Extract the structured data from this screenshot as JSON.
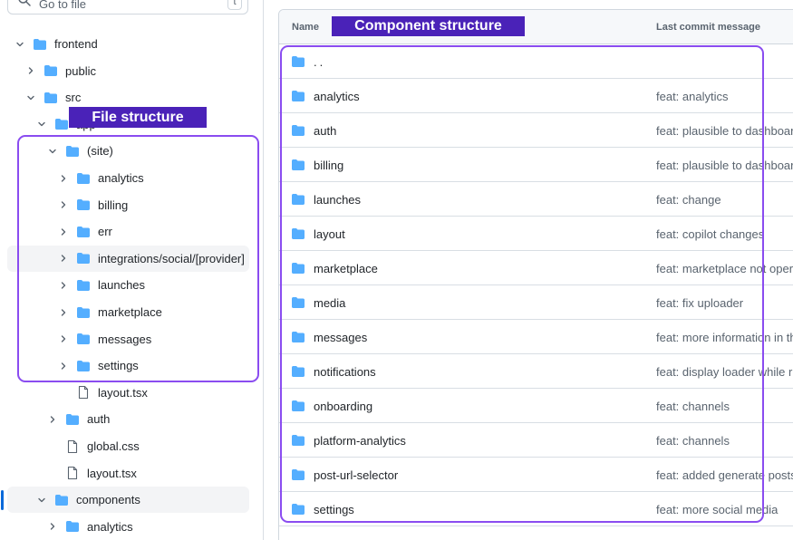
{
  "search": {
    "placeholder": "Go to file",
    "shortcut": "t"
  },
  "tree": [
    {
      "label": "frontend",
      "kind": "folder",
      "expanded": true,
      "depth": 0
    },
    {
      "label": "public",
      "kind": "folder",
      "expanded": false,
      "depth": 1
    },
    {
      "label": "src",
      "kind": "folder",
      "expanded": true,
      "depth": 1
    },
    {
      "label": "app",
      "kind": "folder",
      "expanded": true,
      "depth": 2
    },
    {
      "label": "(site)",
      "kind": "folder",
      "expanded": true,
      "depth": 3
    },
    {
      "label": "analytics",
      "kind": "folder",
      "expanded": false,
      "depth": 4
    },
    {
      "label": "billing",
      "kind": "folder",
      "expanded": false,
      "depth": 4
    },
    {
      "label": "err",
      "kind": "folder",
      "expanded": false,
      "depth": 4
    },
    {
      "label": "integrations/social/[provider]",
      "kind": "folder",
      "expanded": false,
      "depth": 4,
      "highlighted": true
    },
    {
      "label": "launches",
      "kind": "folder",
      "expanded": false,
      "depth": 4
    },
    {
      "label": "marketplace",
      "kind": "folder",
      "expanded": false,
      "depth": 4
    },
    {
      "label": "messages",
      "kind": "folder",
      "expanded": false,
      "depth": 4
    },
    {
      "label": "settings",
      "kind": "folder",
      "expanded": false,
      "depth": 4
    },
    {
      "label": "layout.tsx",
      "kind": "file",
      "depth": 4
    },
    {
      "label": "auth",
      "kind": "folder",
      "expanded": false,
      "depth": 3
    },
    {
      "label": "global.css",
      "kind": "file",
      "depth": 3
    },
    {
      "label": "layout.tsx",
      "kind": "file",
      "depth": 3
    },
    {
      "label": "components",
      "kind": "folder",
      "expanded": true,
      "depth": 2,
      "highlighted": true,
      "active": true
    },
    {
      "label": "analytics",
      "kind": "folder",
      "expanded": false,
      "depth": 3
    }
  ],
  "listing": {
    "headers": {
      "name": "Name",
      "message": "Last commit message"
    },
    "rows": [
      {
        "name": "..",
        "message": ""
      },
      {
        "name": "analytics",
        "message": "feat: analytics"
      },
      {
        "name": "auth",
        "message": "feat: plausible to dashboard"
      },
      {
        "name": "billing",
        "message": "feat: plausible to dashboard"
      },
      {
        "name": "launches",
        "message": "feat: change"
      },
      {
        "name": "layout",
        "message": "feat: copilot changes"
      },
      {
        "name": "marketplace",
        "message": "feat: marketplace not operational"
      },
      {
        "name": "media",
        "message": "feat: fix uploader"
      },
      {
        "name": "messages",
        "message": "feat: more information in the"
      },
      {
        "name": "notifications",
        "message": "feat: display loader while r"
      },
      {
        "name": "onboarding",
        "message": "feat: channels"
      },
      {
        "name": "platform-analytics",
        "message": "feat: channels"
      },
      {
        "name": "post-url-selector",
        "message": "feat: added generate posts"
      },
      {
        "name": "settings",
        "message": "feat: more social media"
      }
    ]
  },
  "annotations": {
    "file_structure": "File structure",
    "component_structure": "Component structure"
  },
  "colors": {
    "folder": "#54aeff",
    "annotation_border": "#8a4cf0",
    "annotation_fill": "#4a22b8",
    "active_marker": "#0969da"
  },
  "icons": {
    "folder": "folder-icon",
    "file": "file-icon",
    "expand": "chevron-down-icon",
    "collapse": "chevron-right-icon",
    "search": "search-icon"
  }
}
